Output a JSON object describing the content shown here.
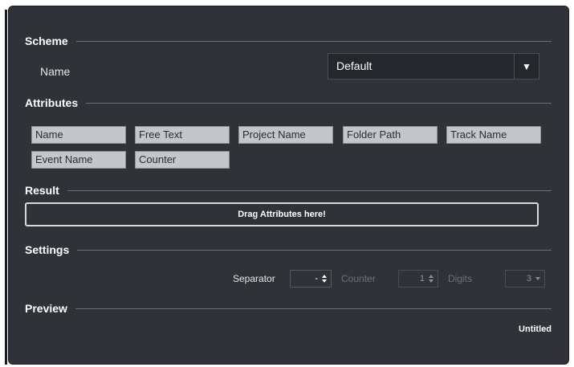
{
  "scheme": {
    "title": "Scheme",
    "name_label": "Name",
    "name_value": "Default",
    "dropdown_arrow": "▼"
  },
  "attributes": {
    "title": "Attributes",
    "chips": [
      "Name",
      "Free Text",
      "Project Name",
      "Folder Path",
      "Track Name",
      "Event Name",
      "Counter"
    ]
  },
  "result": {
    "title": "Result",
    "drop_hint": "Drag Attributes here!"
  },
  "settings": {
    "title": "Settings",
    "separator_label": "Separator",
    "separator_value": "-",
    "counter_label": "Counter",
    "counter_value": "1",
    "digits_label": "Digits",
    "digits_value": "3"
  },
  "preview": {
    "title": "Preview",
    "value": "Untitled"
  },
  "colors": {
    "panel_bg": "#2f3338",
    "chip_bg": "#c4c6c9",
    "disabled_text": "#6e7278"
  }
}
